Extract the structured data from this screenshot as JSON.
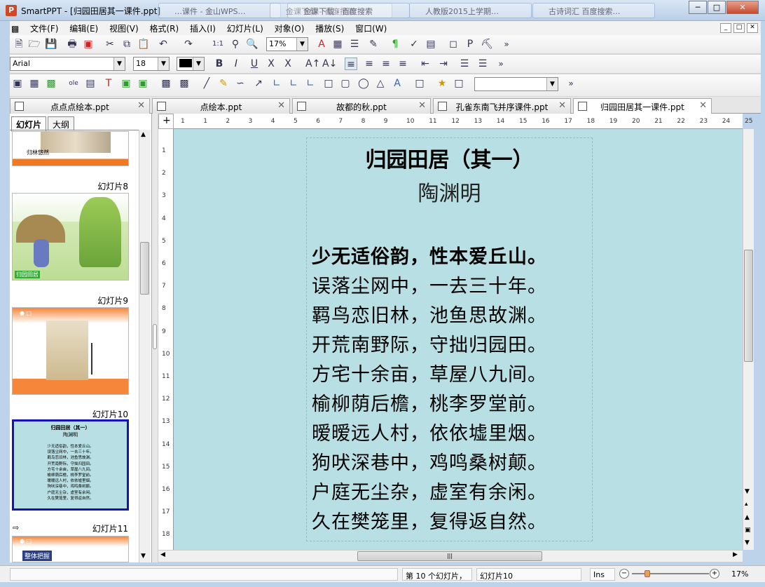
{
  "app": {
    "name": "SmartPPT",
    "window_title": "SmartPPT - [归园田居其一课件.ppt]",
    "window_controls": [
      "minimize",
      "maximize",
      "close"
    ]
  },
  "taskbar_ghosts": [
    "…课件 - 金山WPS…",
    "金课下载 - 百度搜索",
    "金课下载 - 百度搜索",
    "人教版2015上学期…",
    "古诗词汇 百度搜索…"
  ],
  "menu": [
    "文件(F)",
    "编辑(E)",
    "视图(V)",
    "格式(R)",
    "插入(I)",
    "幻灯片(L)",
    "对象(O)",
    "播放(S)",
    "窗口(W)"
  ],
  "toolbar": {
    "zoom_value": "17%",
    "font_name": "Arial",
    "font_size": "18",
    "overflow": "»"
  },
  "doc_tabs": [
    {
      "label": "点点点绘本.ppt",
      "active": false
    },
    {
      "label": "点绘本.ppt",
      "active": false
    },
    {
      "label": "故都的秋.ppt",
      "active": false
    },
    {
      "label": "孔雀东南飞并序课件.ppt",
      "active": false
    },
    {
      "label": "归园田居其一课件.ppt",
      "active": true
    }
  ],
  "panel_tabs": [
    "幻灯片",
    "大纲"
  ],
  "slides_panel": {
    "captions": [
      "幻灯片8",
      "幻灯片9",
      "幻灯片10",
      "幻灯片11"
    ],
    "thumb7_text": "归林悠然",
    "thumb8_text": "归园田居",
    "thumb11_text": "整体把握",
    "thumb10_title": "归园田居（其一）",
    "thumb10_author": "陶渊明",
    "thumb10_lines": [
      "少无适俗韵，性本爱丘山。",
      "误落尘网中，一去三十年。",
      "羁鸟恋旧林，池鱼思故渊。",
      "开荒南野际，守拙归园田。",
      "方宅十余亩，草屋八九间。",
      "榆柳荫后檐，桃李罗堂前。",
      "暧暧远人村，依依墟里烟。",
      "狗吠深巷中，鸡鸣桑树颠。",
      "户庭无尘杂，虚室有余闲。",
      "久在樊笼里，复得返自然。"
    ]
  },
  "ruler": {
    "h_numbers": [
      "1",
      "1",
      "2",
      "3",
      "4",
      "5",
      "6",
      "7",
      "8",
      "9",
      "10",
      "11",
      "12",
      "13",
      "14",
      "15",
      "16",
      "17",
      "18",
      "19",
      "20",
      "21",
      "22",
      "23",
      "24",
      "25"
    ],
    "v_numbers": [
      "1",
      "2",
      "3",
      "4",
      "5",
      "6",
      "7",
      "8",
      "9",
      "10",
      "11",
      "12",
      "13",
      "14",
      "15",
      "16",
      "17",
      "18"
    ]
  },
  "slide": {
    "title": "归园田居（其一）",
    "author": "陶渊明",
    "lines": [
      "少无适俗韵，性本爱丘山。",
      "误落尘网中，一去三十年。",
      "羁鸟恋旧林，池鱼思故渊。",
      "开荒南野际，守拙归园田。",
      "方宅十余亩，草屋八九间。",
      "榆柳荫后檐，桃李罗堂前。",
      "暧暧远人村，依依墟里烟。",
      "狗吠深巷中，鸡鸣桑树颠。",
      "户庭无尘杂，虚室有余闲。",
      "久在樊笼里，复得返自然。"
    ],
    "background": "#b8dfe3"
  },
  "status": {
    "slide_position": "第 10 个幻灯片，",
    "slide_name": "幻灯片10",
    "ins": "Ins",
    "zoom": "17%",
    "zoom_level": 0.2
  }
}
